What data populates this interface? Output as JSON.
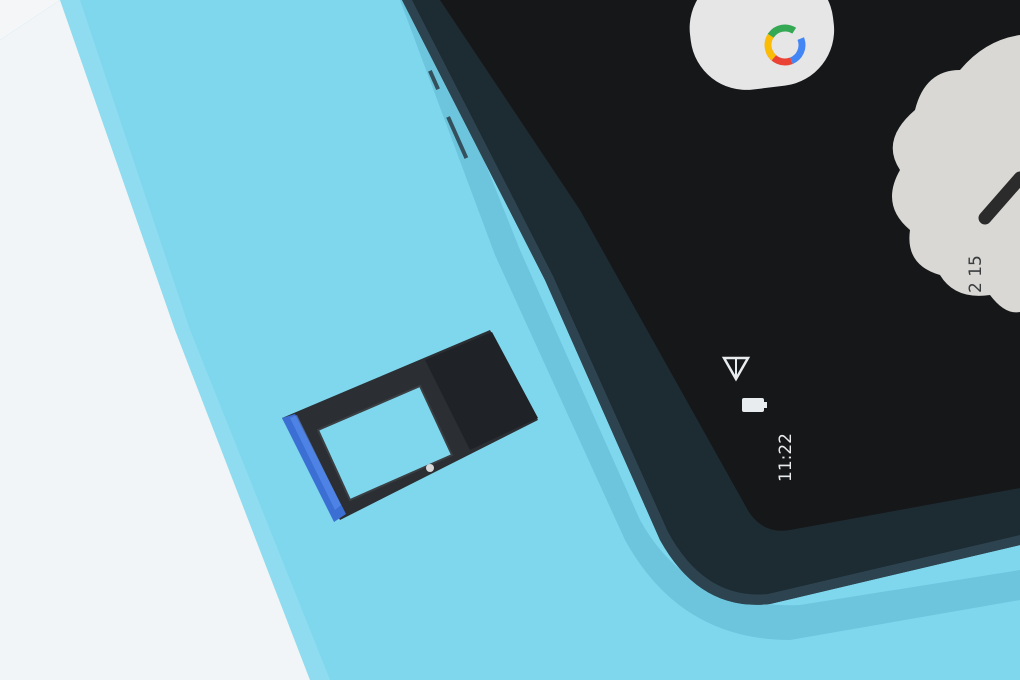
{
  "photo": {
    "background_color": "#7fd7ee",
    "white_surface_color": "#f4f6f7",
    "tablet_color": "#1d2b33",
    "screen_color": "#1a1b1d",
    "tray_color": "#2b2f33",
    "tray_accent_color": "#3b6fd4"
  },
  "tablet_screen": {
    "clock_text": "11:22",
    "date_text": "2 15",
    "search_bar_icon": "google-g-icon",
    "status_icons": [
      "network-triangle-icon",
      "battery-icon"
    ]
  }
}
